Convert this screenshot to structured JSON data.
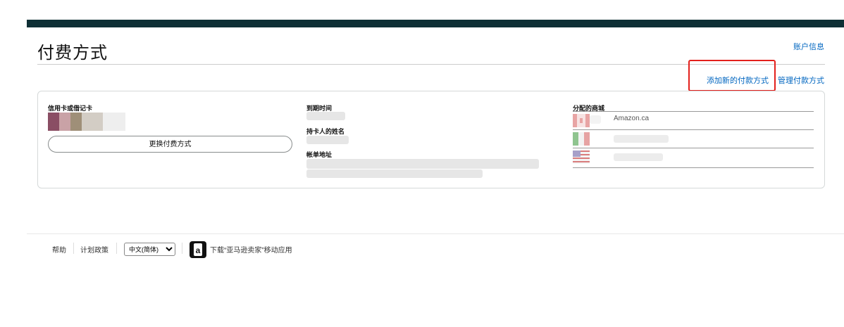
{
  "header": {
    "title": "付费方式",
    "account_info_link": "账户信息"
  },
  "actions": {
    "add_payment": "添加新的付款方式",
    "manage_payment": "管理付款方式",
    "highlight_color": "#e3201c"
  },
  "payment_card": {
    "card_label": "信用卡或借记卡",
    "card_swatch_colors": [
      "#8a4e64",
      "#c9a2a6",
      "#9f8f78",
      "#d3cdc5",
      "#e5e5e5"
    ],
    "replace_button": "更换付费方式",
    "expiry_label": "到期时间",
    "holder_label": "持卡人的姓名",
    "billing_label": "帐单地址",
    "marketplaces_label": "分配的商城",
    "marketplaces": [
      {
        "name": "Amazon.ca",
        "flag_icon": "canada-flag-icon"
      },
      {
        "name": "",
        "flag_icon": "mexico-flag-icon"
      },
      {
        "name": "",
        "flag_icon": "usa-flag-icon"
      }
    ]
  },
  "footer": {
    "help": "帮助",
    "program_policy": "计划政策",
    "language_selected": "中文(简体)",
    "app_download": "下载“亚马逊卖家”移动应用",
    "app_icon": "amazon-app-icon"
  },
  "colors": {
    "top_bar": "#0e2f35",
    "link": "#0066c0"
  }
}
